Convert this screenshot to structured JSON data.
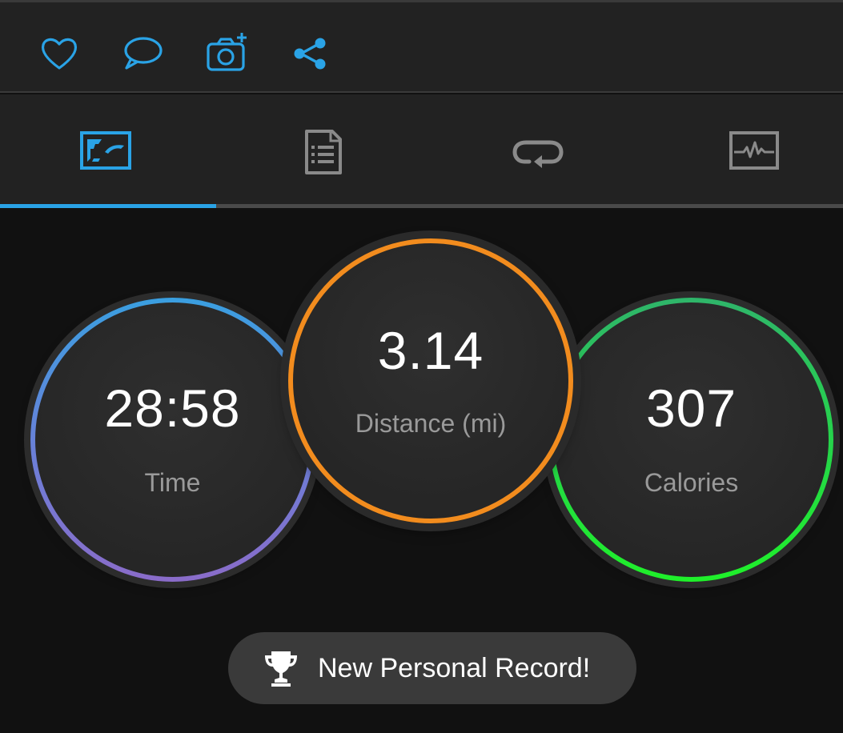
{
  "colors": {
    "accent": "#2aa3e6",
    "time_ring": "#3a9fe0",
    "distance_ring": "#f28c1e",
    "calories_ring": "#25d648"
  },
  "actions": [
    {
      "icon": "heart-icon"
    },
    {
      "icon": "comment-icon"
    },
    {
      "icon": "camera-add-icon"
    },
    {
      "icon": "share-icon"
    }
  ],
  "tabs": [
    {
      "icon": "map-overview-icon",
      "active": true
    },
    {
      "icon": "details-document-icon",
      "active": false
    },
    {
      "icon": "laps-loop-icon",
      "active": false
    },
    {
      "icon": "chart-activity-icon",
      "active": false
    }
  ],
  "stats": {
    "time": {
      "value": "28:58",
      "label": "Time"
    },
    "distance": {
      "value": "3.14",
      "label": "Distance (mi)"
    },
    "calories": {
      "value": "307",
      "label": "Calories"
    }
  },
  "personal_record": {
    "icon": "trophy-icon",
    "text": "New Personal Record!"
  }
}
